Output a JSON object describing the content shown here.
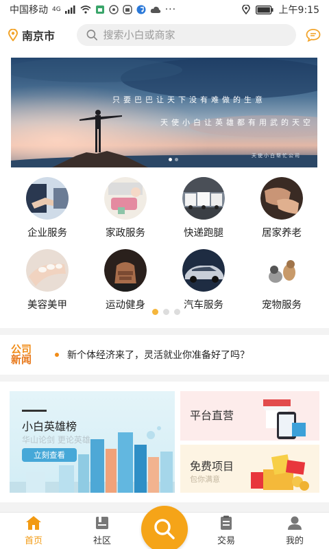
{
  "status_bar": {
    "carrier": "中国移动",
    "network": "4G",
    "time": "上午9:15"
  },
  "header": {
    "location_icon": "location-pin-icon",
    "city": "南京市",
    "search_icon": "search-icon",
    "search_placeholder": "搜索小白或商家",
    "message_icon": "chat-bubble-icon"
  },
  "banner": {
    "line1": "只要巴巴让天下没有难做的生意",
    "line2": "天使小白让英雄都有用武的天空",
    "caption": "天使小白帮忙公司",
    "slide_count": 2,
    "active_slide": 1
  },
  "services": [
    {
      "label": "企业服务",
      "icon": "handshake-icon"
    },
    {
      "label": "家政服务",
      "icon": "cleaning-icon"
    },
    {
      "label": "快递跑腿",
      "icon": "delivery-truck-icon"
    },
    {
      "label": "居家养老",
      "icon": "elderly-care-icon"
    },
    {
      "label": "美容美甲",
      "icon": "manicure-icon"
    },
    {
      "label": "运动健身",
      "icon": "fitness-icon"
    },
    {
      "label": "汽车服务",
      "icon": "car-icon"
    },
    {
      "label": "宠物服务",
      "icon": "pet-icon"
    }
  ],
  "service_pager": {
    "pages": 3,
    "active": 1
  },
  "news": {
    "logo_line1": "公司",
    "logo_line2": "新闻",
    "text": "新个体经济来了，灵活就业你准备好了吗？"
  },
  "promo": {
    "hero_title": "小白英雄榜",
    "hero_subtitle": "华山论剑 更论英雄",
    "hero_button": "立刻查看",
    "card1_title": "平台直营",
    "card2_title": "免费项目",
    "card2_subtitle": "包你满意"
  },
  "tabs": [
    {
      "label": "首页",
      "icon": "home-icon",
      "active": true
    },
    {
      "label": "社区",
      "icon": "community-icon",
      "active": false
    },
    {
      "label": "交易",
      "icon": "clipboard-icon",
      "active": false
    },
    {
      "label": "我的",
      "icon": "user-icon",
      "active": false
    }
  ],
  "fab_icon": "search-icon",
  "colors": {
    "accent": "#f5a418",
    "active_tab": "#f29a12",
    "hero_button": "#46a8d8"
  }
}
